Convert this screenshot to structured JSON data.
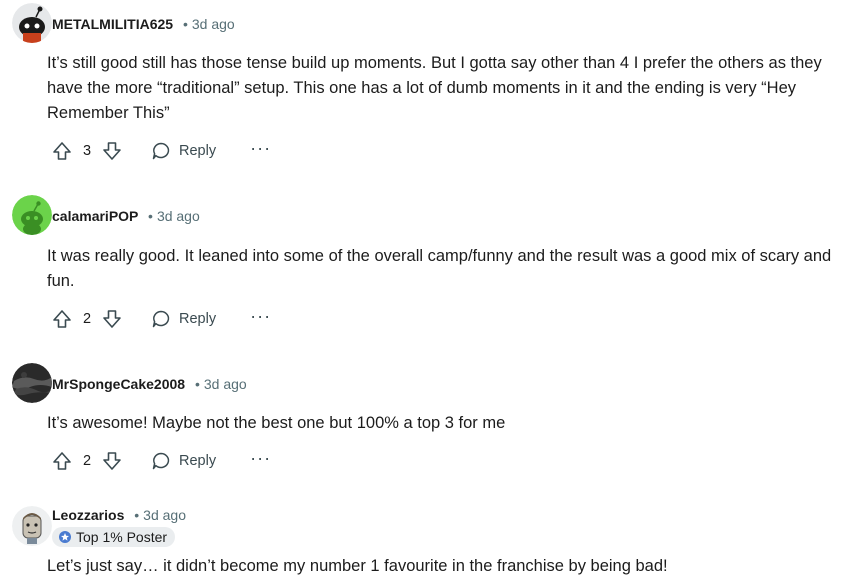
{
  "comments": [
    {
      "author": "METALMILITIA625",
      "time": "3d ago",
      "body": "It’s still good still has those tense build up moments. But I gotta say other than 4 I prefer the others as they have the more “traditional” setup. This one has a lot of dumb moments in it and the ending is very “Hey Remember This”",
      "score": "3",
      "reply_label": "Reply",
      "avatar_icon": "snoo-avatar-black"
    },
    {
      "author": "calamariPOP",
      "time": "3d ago",
      "body": "It was really good. It leaned into some of the overall camp/funny and the result was a good mix of scary and fun.",
      "score": "2",
      "reply_label": "Reply",
      "avatar_icon": "snoo-avatar-green"
    },
    {
      "author": "MrSpongeCake2008",
      "time": "3d ago",
      "body": "It’s awesome! Maybe not the best one but 100% a top 3 for me",
      "score": "2",
      "reply_label": "Reply",
      "avatar_icon": "photo-avatar-dark"
    },
    {
      "author": "Leozzarios",
      "time": "3d ago",
      "flair": "Top 1% Poster",
      "body": "Let’s just say… it didn’t become my number 1 favourite in the franchise by being bad!",
      "avatar_icon": "cartoon-face-avatar"
    }
  ],
  "more_label": "···",
  "colors": {
    "meta": "#576f76",
    "text": "#1c1c1c",
    "flair_bg": "#eaedef",
    "green_avatar": "#6bd34a"
  }
}
